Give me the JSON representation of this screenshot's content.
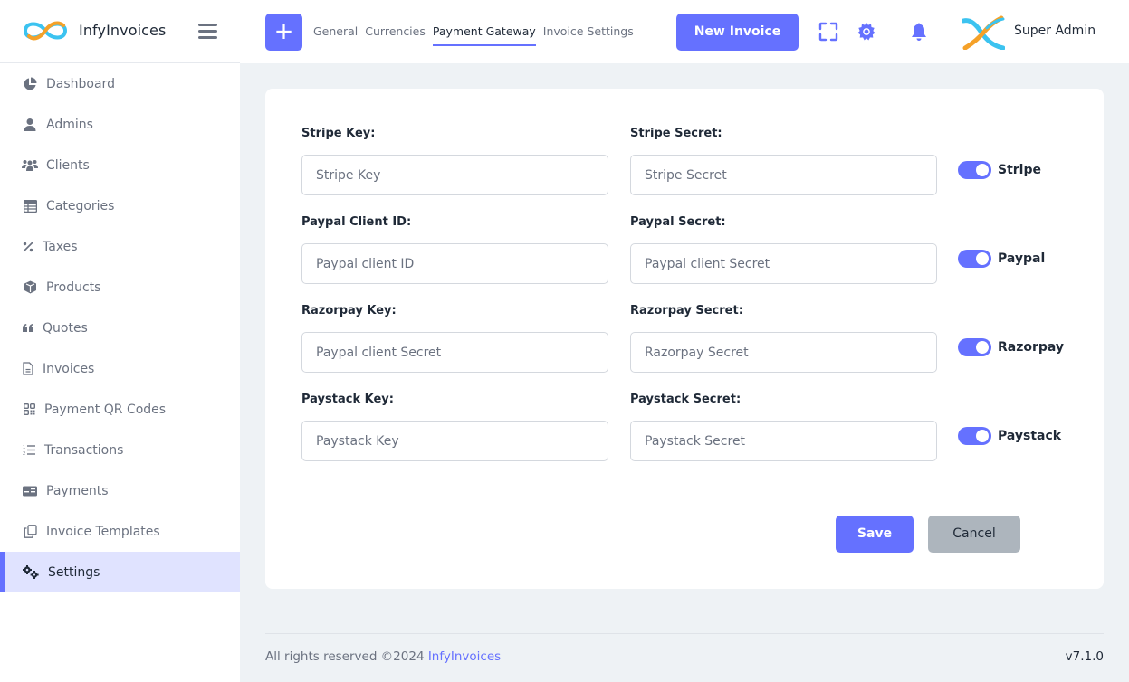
{
  "app": {
    "name": "InfyInvoices"
  },
  "header": {
    "tabs": [
      {
        "label": "General",
        "active": false
      },
      {
        "label": "Currencies",
        "active": false
      },
      {
        "label": "Payment Gateway",
        "active": true
      },
      {
        "label": "Invoice Settings",
        "active": false
      }
    ],
    "new_invoice_label": "New Invoice",
    "user_name": "Super Admin",
    "icons": [
      "plus-icon",
      "fullscreen-icon",
      "gear-icon",
      "bell-icon"
    ]
  },
  "sidebar": {
    "items": [
      {
        "label": "Dashboard",
        "icon": "pie-chart-icon",
        "active": false
      },
      {
        "label": "Admins",
        "icon": "user-icon",
        "active": false
      },
      {
        "label": "Clients",
        "icon": "users-icon",
        "active": false
      },
      {
        "label": "Categories",
        "icon": "table-list-icon",
        "active": false
      },
      {
        "label": "Taxes",
        "icon": "percent-icon",
        "active": false
      },
      {
        "label": "Products",
        "icon": "cube-icon",
        "active": false
      },
      {
        "label": "Quotes",
        "icon": "quote-icon",
        "active": false
      },
      {
        "label": "Invoices",
        "icon": "file-icon",
        "active": false
      },
      {
        "label": "Payment QR Codes",
        "icon": "qrcode-icon",
        "active": false
      },
      {
        "label": "Transactions",
        "icon": "list-ol-icon",
        "active": false
      },
      {
        "label": "Payments",
        "icon": "credit-card-icon",
        "active": false
      },
      {
        "label": "Invoice Templates",
        "icon": "copy-icon",
        "active": false
      },
      {
        "label": "Settings",
        "icon": "cogs-icon",
        "active": true
      }
    ]
  },
  "form": {
    "rows": [
      {
        "key_label": "Stripe Key:",
        "key_placeholder": "Stripe Key",
        "key_value": "",
        "secret_label": "Stripe Secret:",
        "secret_placeholder": "Stripe Secret",
        "secret_value": "",
        "toggle_label": "Stripe",
        "enabled": true
      },
      {
        "key_label": "Paypal Client ID:",
        "key_placeholder": "Paypal client ID",
        "key_value": "",
        "secret_label": "Paypal Secret:",
        "secret_placeholder": "Paypal client Secret",
        "secret_value": "",
        "toggle_label": "Paypal",
        "enabled": true
      },
      {
        "key_label": "Razorpay Key:",
        "key_placeholder": "Paypal client Secret",
        "key_value": "",
        "secret_label": "Razorpay Secret:",
        "secret_placeholder": "Razorpay Secret",
        "secret_value": "",
        "toggle_label": "Razorpay",
        "enabled": true
      },
      {
        "key_label": "Paystack Key:",
        "key_placeholder": "Paystack Key",
        "key_value": "",
        "secret_label": "Paystack Secret:",
        "secret_placeholder": "Paystack Secret",
        "secret_value": "",
        "toggle_label": "Paystack",
        "enabled": true
      }
    ],
    "save_label": "Save",
    "cancel_label": "Cancel"
  },
  "footer": {
    "copyright": "All rights reserved ©2024 ",
    "brand_link": "InfyInvoices",
    "version": "v7.1.0"
  },
  "colors": {
    "accent": "#6571ff",
    "active_nav_bg": "#e0e3ff",
    "cancel_bg": "#adb5bd",
    "page_bg": "#eef2f5"
  }
}
